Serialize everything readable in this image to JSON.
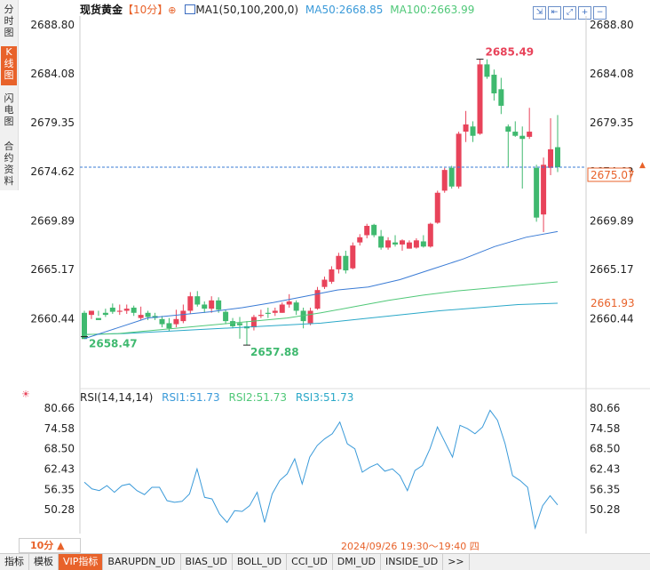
{
  "sidebar": {
    "tabs": [
      {
        "label": "分时图",
        "active": false
      },
      {
        "label": "K线图",
        "active": true
      },
      {
        "label": "闪电图",
        "active": false
      },
      {
        "label": "合约资料",
        "active": false
      }
    ]
  },
  "header": {
    "symbol": "现货黄金",
    "period": "【10分】",
    "ma_label": "MA1(50,100,200,0)",
    "ma50": "MA50:2668.85",
    "ma100": "MA100:2663.99"
  },
  "rsi_header": {
    "label": "RSI(14,14,14)",
    "rsi1": "RSI1:51.73",
    "rsi2": "RSI2:51.73",
    "rsi3": "RSI3:51.73"
  },
  "footer": {
    "period_select": "10分 ▲",
    "timestamp": "2024/09/26 19:30～19:40 四",
    "tabs": [
      "指标",
      "模板",
      "VIP指标",
      "BARUPDN_UD",
      "BIAS_UD",
      "BOLL_UD",
      "CCI_UD",
      "DMI_UD",
      "INSIDE_UD",
      ">>"
    ]
  },
  "colors": {
    "up": "#e8435a",
    "down": "#3fb96f",
    "ma50": "#3a7bd5",
    "ma100": "#50c878",
    "ma200": "#2aa8c8",
    "rsi": "#3a9ad9",
    "accent": "#e8622a"
  },
  "chart_data": [
    {
      "type": "candlestick",
      "title": "现货黄金",
      "ylim": [
        2656.0,
        2689.5
      ],
      "yticks": [
        "2688.80",
        "2684.08",
        "2679.35",
        "2674.62",
        "2669.89",
        "2665.17",
        "2660.44"
      ],
      "current_price": "2675.07",
      "ma_value_label": "2661.93",
      "high_label": "2685.49",
      "low_labels": [
        "2658.47",
        "2657.88"
      ],
      "candles": [
        [
          2661.0,
          2661.2,
          2658.7,
          2658.47
        ],
        [
          2660.8,
          2661.0,
          2660.4,
          2661.2
        ],
        [
          2660.5,
          2661.2,
          2660.7,
          2660.3
        ],
        [
          2661.0,
          2661.4,
          2660.6,
          2660.8
        ],
        [
          2661.5,
          2661.9,
          2660.9,
          2661.1
        ],
        [
          2661.1,
          2661.8,
          2660.8,
          2661.2
        ],
        [
          2661.2,
          2661.8,
          2660.9,
          2661.4
        ],
        [
          2661.5,
          2661.7,
          2660.7,
          2661.0
        ],
        [
          2660.5,
          2661.6,
          2660.3,
          2660.8
        ],
        [
          2661.0,
          2661.2,
          2660.3,
          2660.6
        ],
        [
          2660.7,
          2661.0,
          2660.3,
          2660.5
        ],
        [
          2660.4,
          2660.7,
          2659.6,
          2659.9
        ],
        [
          2660.0,
          2660.5,
          2659.2,
          2659.5
        ],
        [
          2659.9,
          2661.3,
          2659.6,
          2660.4
        ],
        [
          2660.2,
          2661.8,
          2660.0,
          2661.2
        ],
        [
          2661.2,
          2663.0,
          2660.9,
          2662.6
        ],
        [
          2662.6,
          2663.1,
          2661.6,
          2661.8
        ],
        [
          2661.8,
          2662.1,
          2661.0,
          2661.4
        ],
        [
          2661.4,
          2662.6,
          2661.0,
          2662.2
        ],
        [
          2662.2,
          2662.5,
          2661.0,
          2661.3
        ],
        [
          2661.1,
          2661.3,
          2659.9,
          2660.2
        ],
        [
          2660.2,
          2660.5,
          2659.5,
          2659.7
        ],
        [
          2660.0,
          2660.6,
          2658.5,
          2659.8
        ],
        [
          2659.7,
          2660.2,
          2657.88,
          2659.5
        ],
        [
          2659.6,
          2660.8,
          2659.3,
          2660.6
        ],
        [
          2660.7,
          2661.3,
          2660.5,
          2660.8
        ],
        [
          2661.0,
          2661.5,
          2660.5,
          2660.9
        ],
        [
          2661.0,
          2661.5,
          2660.7,
          2661.2
        ],
        [
          2661.0,
          2662.0,
          2661.0,
          2661.8
        ],
        [
          2661.8,
          2662.8,
          2661.5,
          2662.1
        ],
        [
          2662.0,
          2662.2,
          2660.8,
          2661.2
        ],
        [
          2661.2,
          2661.5,
          2659.5,
          2660.2
        ],
        [
          2660.0,
          2661.5,
          2659.8,
          2661.2
        ],
        [
          2661.4,
          2663.5,
          2661.3,
          2663.2
        ],
        [
          2663.5,
          2664.5,
          2663.3,
          2664.2
        ],
        [
          2664.0,
          2665.5,
          2663.8,
          2665.2
        ],
        [
          2665.2,
          2666.8,
          2664.8,
          2666.5
        ],
        [
          2666.5,
          2667.0,
          2664.8,
          2665.1
        ],
        [
          2665.3,
          2667.8,
          2665.2,
          2667.5
        ],
        [
          2667.8,
          2668.6,
          2667.5,
          2668.3
        ],
        [
          2668.5,
          2669.6,
          2668.2,
          2669.4
        ],
        [
          2669.5,
          2669.6,
          2668.3,
          2668.5
        ],
        [
          2668.4,
          2669.0,
          2667.1,
          2667.3
        ],
        [
          2667.3,
          2668.3,
          2667.1,
          2668.0
        ],
        [
          2667.8,
          2668.5,
          2667.4,
          2667.6
        ],
        [
          2667.6,
          2668.1,
          2667.0,
          2668.0
        ],
        [
          2667.2,
          2668.0,
          2667.2,
          2667.8
        ],
        [
          2667.3,
          2668.2,
          2667.2,
          2668.0
        ],
        [
          2667.9,
          2668.5,
          2667.3,
          2667.4
        ],
        [
          2667.4,
          2669.7,
          2667.3,
          2669.6
        ],
        [
          2669.7,
          2672.8,
          2669.6,
          2672.6
        ],
        [
          2672.8,
          2675.0,
          2672.6,
          2674.8
        ],
        [
          2675.0,
          2675.2,
          2673.0,
          2673.2
        ],
        [
          2673.2,
          2678.5,
          2673.0,
          2678.3
        ],
        [
          2678.5,
          2680.5,
          2677.5,
          2679.2
        ],
        [
          2679.0,
          2679.5,
          2677.5,
          2678.1
        ],
        [
          2678.3,
          2685.5,
          2678.2,
          2685.0
        ],
        [
          2685.0,
          2685.49,
          2683.6,
          2683.8
        ],
        [
          2684.0,
          2684.5,
          2681.5,
          2682.2
        ],
        [
          2682.6,
          2683.7,
          2680.2,
          2681.0
        ],
        [
          2679.0,
          2679.2,
          2675.1,
          2678.5
        ],
        [
          2678.5,
          2679.5,
          2678.0,
          2678.1
        ],
        [
          2678.1,
          2679.0,
          2673.0,
          2677.8
        ],
        [
          2678.0,
          2680.8,
          2677.8,
          2678.5
        ],
        [
          2675.0,
          2675.3,
          2669.8,
          2670.2
        ],
        [
          2670.5,
          2676.0,
          2668.8,
          2675.3
        ],
        [
          2675.0,
          2679.8,
          2674.3,
          2676.8
        ],
        [
          2677.0,
          2680.1,
          2674.6,
          2675.07
        ]
      ],
      "ma50": [
        2658.5,
        2659.5,
        2660.5,
        2660.8,
        2661.1,
        2661.5,
        2662.0,
        2662.6,
        2663.2,
        2663.5,
        2664.2,
        2665.2,
        2666.2,
        2667.4,
        2668.3,
        2668.85
      ],
      "ma100": [
        2658.9,
        2659.0,
        2659.3,
        2659.6,
        2659.9,
        2660.2,
        2660.5,
        2661.0,
        2661.6,
        2662.2,
        2662.7,
        2663.1,
        2663.4,
        2663.7,
        2663.99
      ],
      "ma200": [
        2658.9,
        2659.0,
        2659.2,
        2659.4,
        2659.6,
        2659.8,
        2660.0,
        2660.4,
        2660.8,
        2661.2,
        2661.5,
        2661.8,
        2661.93
      ]
    },
    {
      "type": "line",
      "title": "RSI(14,14,14)",
      "ylim": [
        44.5,
        82.5
      ],
      "yticks": [
        "80.66",
        "74.58",
        "68.50",
        "62.43",
        "56.35",
        "50.28"
      ],
      "series": [
        {
          "name": "RSI1",
          "values": [
            58.5,
            56.5,
            56.0,
            57.5,
            55.5,
            57.5,
            58.0,
            56.0,
            54.8,
            57.0,
            57.0,
            53.0,
            52.5,
            52.8,
            55.0,
            62.5,
            54.0,
            53.5,
            49.0,
            46.5,
            50.0,
            49.8,
            51.5,
            55.5,
            46.5,
            55.0,
            59.0,
            61.0,
            65.5,
            58.0,
            66.0,
            69.5,
            71.5,
            73.0,
            76.5,
            70.0,
            68.5,
            61.5,
            63.0,
            64.0,
            61.8,
            62.5,
            60.5,
            56.0,
            62.0,
            63.5,
            68.5,
            75.0,
            70.5,
            66.0,
            75.5,
            74.5,
            73.0,
            75.0,
            80.0,
            77.0,
            70.0,
            60.5,
            59.0,
            57.0,
            44.8,
            51.5,
            54.5,
            51.73
          ]
        }
      ]
    }
  ]
}
